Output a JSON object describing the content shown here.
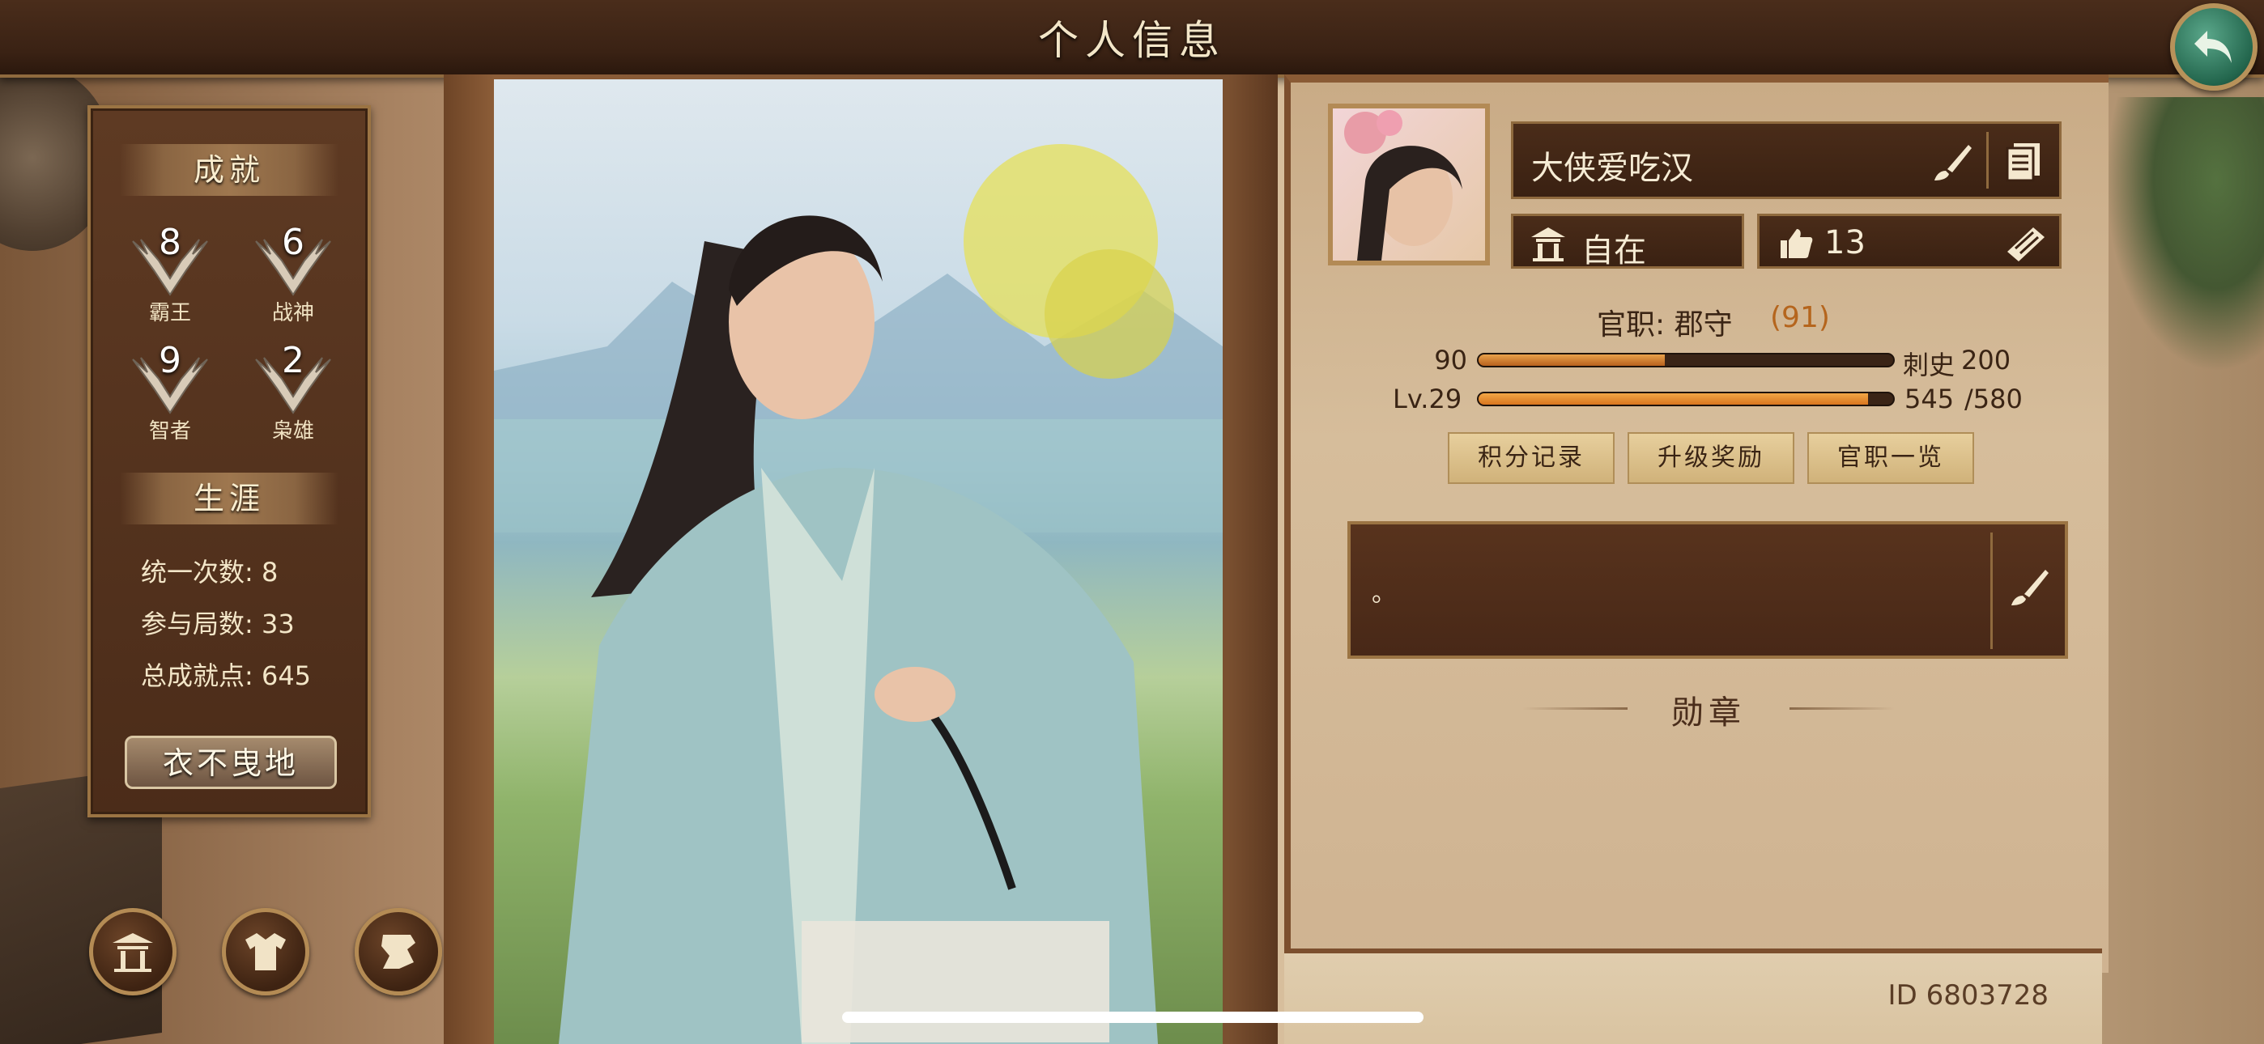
{
  "header": {
    "title": "个人信息"
  },
  "achievements": {
    "title": "成就",
    "badges": [
      {
        "count": "8",
        "label": "霸王"
      },
      {
        "count": "6",
        "label": "战神"
      },
      {
        "count": "9",
        "label": "智者"
      },
      {
        "count": "2",
        "label": "枭雄"
      }
    ]
  },
  "career": {
    "title": "生涯",
    "stats": [
      "统一次数: 8",
      "参与局数: 33",
      "总成就点: 645"
    ]
  },
  "title_tag": "衣不曳地",
  "bottom_buttons": [
    "palace-icon",
    "robe-icon",
    "scroll-icon"
  ],
  "profile": {
    "name": "大侠爱吃汉",
    "status": "自在",
    "likes": "13",
    "rank_label": "官职: 郡守",
    "rank_score": "(91)",
    "rank_bar": {
      "current": "90",
      "next_title": "刺史",
      "next_value": "200",
      "fraction": 0.45
    },
    "level_bar": {
      "level": "Lv.29",
      "current": "545",
      "max": "/580",
      "fraction": 0.94
    },
    "actions": [
      "积分记录",
      "升级奖励",
      "官职一览"
    ],
    "signature": "。"
  },
  "medal_title": "勋章",
  "player_id": "ID 6803728",
  "colors": {
    "accent_green": "#23664d",
    "bar_orange": "#e48a2b",
    "panel_dark": "#4b2c19",
    "gold": "#9b7443"
  }
}
